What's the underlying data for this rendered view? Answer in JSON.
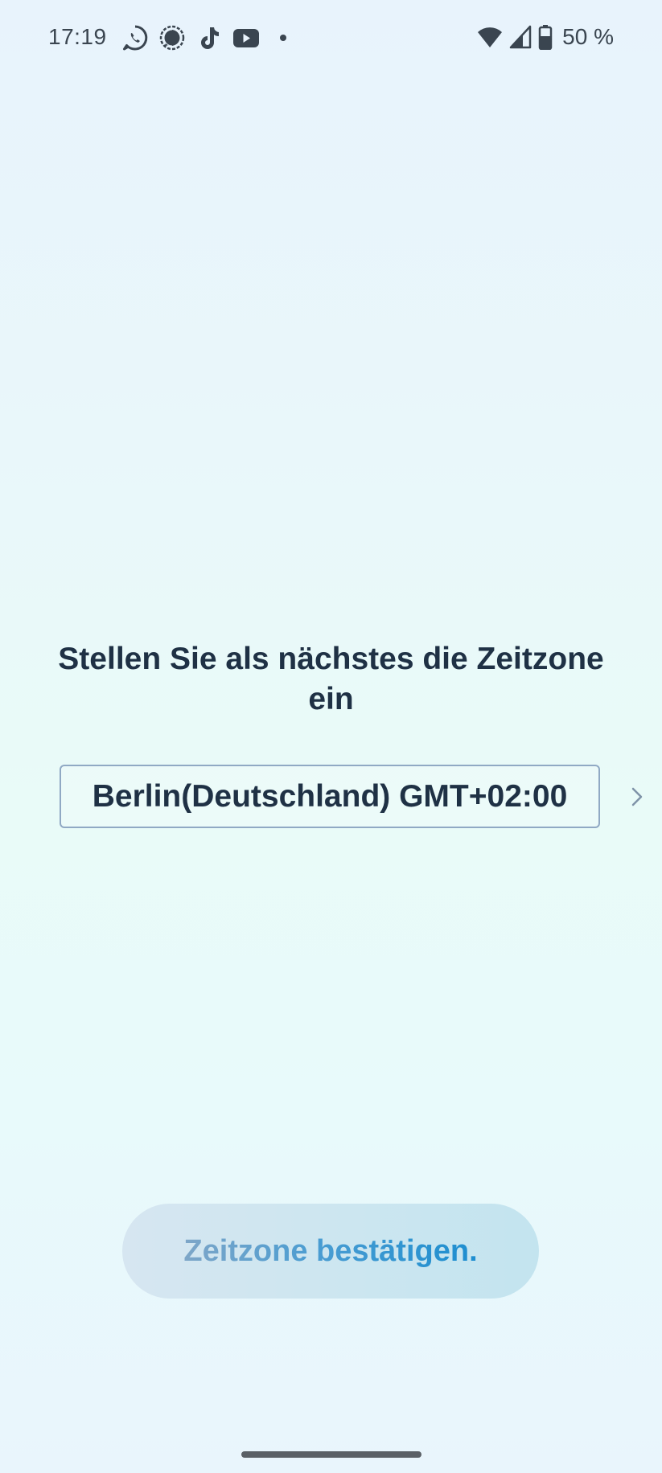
{
  "status_bar": {
    "time": "17:19",
    "notification_icons": [
      "whatsapp-icon",
      "signal-icon",
      "tiktok-icon",
      "youtube-icon",
      "more-dot-icon"
    ],
    "battery_percent": "50 %",
    "system_icons": [
      "wifi-icon",
      "cellular-signal-icon",
      "battery-icon"
    ]
  },
  "main": {
    "title": "Stellen Sie als nächstes die Zeitzone ein",
    "timezone_value": "Berlin(Deutschland) GMT+02:00",
    "confirm_label": "Zeitzone bestätigen."
  },
  "colors": {
    "text_primary": "#1f3145",
    "button_text_accent": "#1d8ed0",
    "box_border": "#90a9c4"
  }
}
